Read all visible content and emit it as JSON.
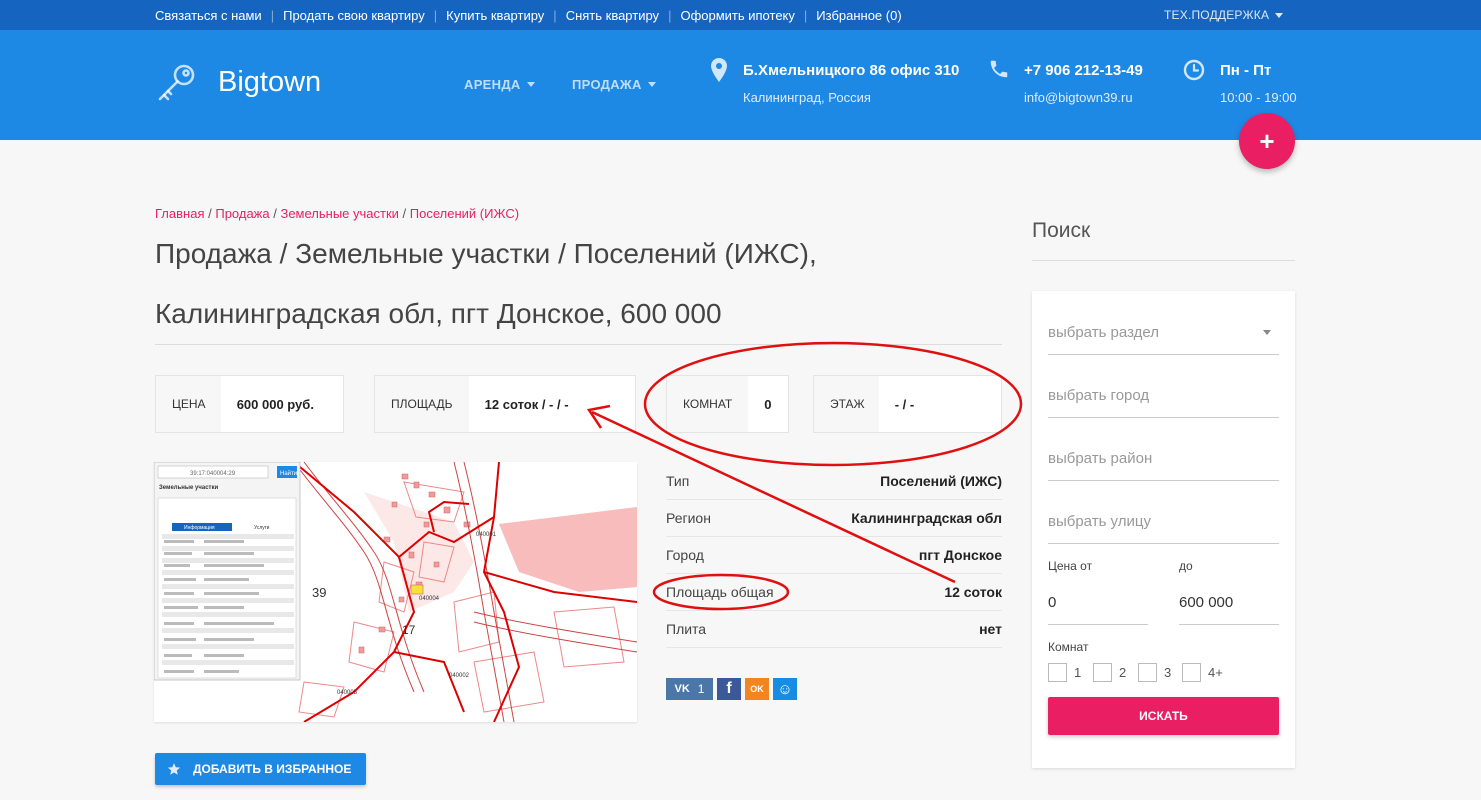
{
  "top_nav": {
    "items": [
      "Связаться с нами",
      "Продать свою квартиру",
      "Купить квартиру",
      "Снять квартиру",
      "Оформить ипотеку",
      "Избранное (0)"
    ],
    "support": "ТЕХ.ПОДДЕРЖКА"
  },
  "header": {
    "logo": "Bigtown",
    "nav": [
      "АРЕНДА",
      "ПРОДАЖА"
    ],
    "address": "Б.Хмельницкого 86 офис 310",
    "city": "Калининград, Россия",
    "phone": "+7 906 212-13-49",
    "email": "info@bigtown39.ru",
    "days": "Пн - Пт",
    "hours": "10:00 - 19:00",
    "add_icon": "plus-icon"
  },
  "breadcrumb": [
    "Главная",
    "Продажа",
    "Земельные участки",
    "Поселений (ИЖС)"
  ],
  "page_title": {
    "line1": "Продажа / Земельные участки / Поселений (ИЖС),",
    "line2": "Калининградская обл, пгт Донское, 600 000"
  },
  "stats": {
    "price_label": "ЦЕНА",
    "price_value": "600 000 руб.",
    "area_label": "ПЛОЩАДЬ",
    "area_value": "12 соток / - / -",
    "rooms_label": "КОМНАТ",
    "rooms_value": "0",
    "floor_label": "ЭТАЖ",
    "floor_value": "- / -"
  },
  "details": [
    {
      "key": "Тип",
      "value": "Поселений (ИЖС)"
    },
    {
      "key": "Регион",
      "value": "Калининградская обл"
    },
    {
      "key": "Город",
      "value": "пгт Донское"
    },
    {
      "key": "Площадь общая",
      "value": "12 соток"
    },
    {
      "key": "Плита",
      "value": "нет"
    }
  ],
  "map": {
    "panel_title": "Земельные участки",
    "search_button": "Найти",
    "cadastral": "39:17:040004:29",
    "tab_info": "Информация",
    "tab_services": "Услуги",
    "labels": [
      "39",
      "17",
      "040004",
      "040001",
      "040002",
      "040005"
    ]
  },
  "social": {
    "vk_label": "VK",
    "vk_count": "1",
    "fb_label": "f",
    "ok_label": "OK",
    "mm_label": "☺"
  },
  "favorite_button": "ДОБАВИТЬ В ИЗБРАННОЕ",
  "sidebar": {
    "title": "Поиск",
    "section_placeholder": "выбрать раздел",
    "city_placeholder": "выбрать город",
    "district_placeholder": "выбрать район",
    "street_placeholder": "выбрать улицу",
    "price_from_label": "Цена от",
    "price_to_label": "до",
    "price_from": "0",
    "price_to": "600 000",
    "rooms_label": "Комнат",
    "room_options": [
      "1",
      "2",
      "3",
      "4+"
    ],
    "search_button": "ИСКАТЬ"
  },
  "colors": {
    "topbar": "#1565c0",
    "header": "#1e88e5",
    "accent": "#e91e63",
    "annotation": "#e01010"
  }
}
